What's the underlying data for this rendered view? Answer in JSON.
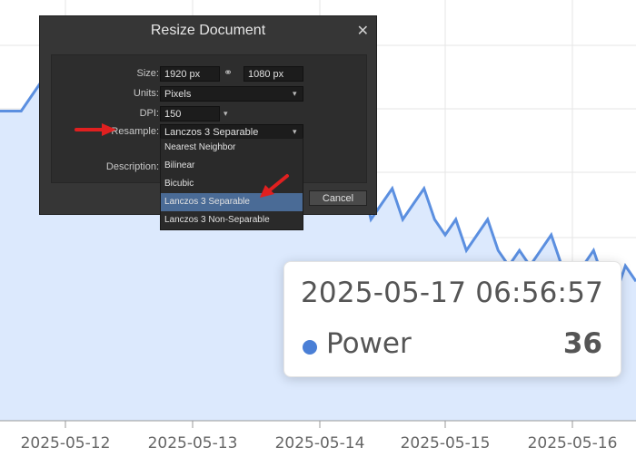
{
  "chart_data": {
    "type": "area",
    "x_tick_labels": [
      "2025-05-12",
      "2025-05-13",
      "2025-05-14",
      "2025-05-15",
      "2025-05-16"
    ],
    "line_color": "#5b8fe0",
    "fill_color": "#dce9fd",
    "grid": true,
    "values": [
      40,
      40,
      40,
      41,
      42,
      40,
      42,
      40,
      41,
      39,
      40,
      38,
      39,
      40,
      38,
      39,
      37,
      38,
      36,
      37,
      36,
      38,
      36,
      35,
      37,
      36,
      38,
      36,
      34,
      35,
      36,
      37,
      34,
      35,
      36,
      33,
      34,
      35,
      33,
      34,
      35,
      33,
      32,
      33,
      31,
      32,
      33,
      31,
      30,
      31,
      30,
      31,
      32,
      30,
      29,
      30,
      31,
      29,
      28,
      30,
      29
    ]
  },
  "tooltip": {
    "timestamp": "2025-05-17 06:56:57",
    "series_name": "Power",
    "value": "36",
    "dot_color": "#4a7fd6"
  },
  "dialog": {
    "title": "Resize Document",
    "close_glyph": "✕",
    "size_label": "Size:",
    "width_value": "1920 px",
    "height_value": "1080 px",
    "units_label": "Units:",
    "units_value": "Pixels",
    "dpi_label": "DPI:",
    "dpi_value": "150",
    "resample_label": "Resample:",
    "resample_value": "Lanczos 3 Separable",
    "description_label": "Description:",
    "cancel_label": "Cancel"
  },
  "dropdown": {
    "options": [
      "Nearest Neighbor",
      "Bilinear",
      "Bicubic",
      "Lanczos 3 Separable",
      "Lanczos 3 Non-Separable"
    ],
    "selected_index": 3
  },
  "annotation_color": "#e02020"
}
